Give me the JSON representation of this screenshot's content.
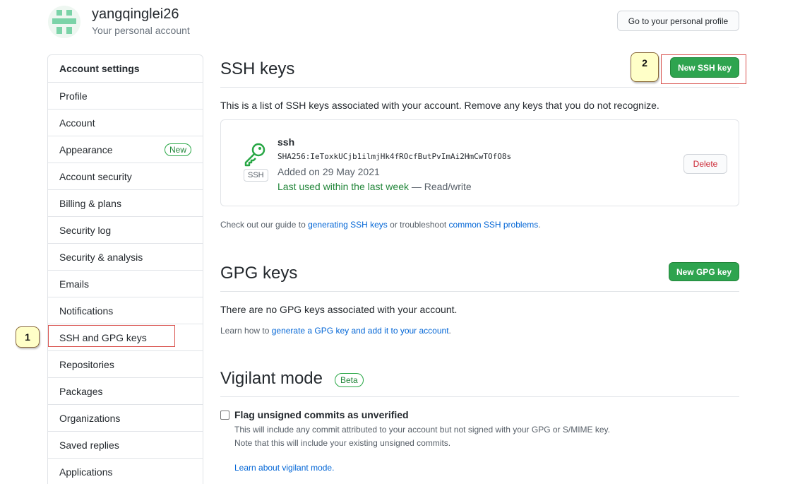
{
  "header": {
    "username": "yangqinglei26",
    "subtitle": "Your personal account",
    "profile_button": "Go to your personal profile"
  },
  "sidebar": {
    "heading": "Account settings",
    "items": [
      {
        "label": "Profile"
      },
      {
        "label": "Account"
      },
      {
        "label": "Appearance",
        "badge": "New"
      },
      {
        "label": "Account security"
      },
      {
        "label": "Billing & plans"
      },
      {
        "label": "Security log"
      },
      {
        "label": "Security & analysis"
      },
      {
        "label": "Emails"
      },
      {
        "label": "Notifications"
      },
      {
        "label": "SSH and GPG keys"
      },
      {
        "label": "Repositories"
      },
      {
        "label": "Packages"
      },
      {
        "label": "Organizations"
      },
      {
        "label": "Saved replies"
      },
      {
        "label": "Applications"
      }
    ]
  },
  "callouts": {
    "one": "1",
    "two": "2"
  },
  "ssh": {
    "title": "SSH keys",
    "new_button": "New SSH key",
    "description": "This is a list of SSH keys associated with your account. Remove any keys that you do not recognize.",
    "key": {
      "name": "ssh",
      "type_label": "SSH",
      "fingerprint": "SHA256:IeToxkUCjb1ilmjHk4fROcfButPvImAi2HmCwTOfO8s",
      "added": "Added on 29 May 2021",
      "last_used": "Last used within the last week",
      "access": " — Read/write",
      "delete_button": "Delete"
    },
    "guide_prefix": "Check out our guide to ",
    "guide_link1": "generating SSH keys",
    "guide_middle": " or troubleshoot ",
    "guide_link2": "common SSH problems",
    "guide_suffix": "."
  },
  "gpg": {
    "title": "GPG keys",
    "new_button": "New GPG key",
    "empty": "There are no GPG keys associated with your account.",
    "learn_prefix": "Learn how to ",
    "learn_link": "generate a GPG key and add it to your account",
    "learn_suffix": "."
  },
  "vigilant": {
    "title": "Vigilant mode",
    "badge": "Beta",
    "checkbox_label": "Flag unsigned commits as unverified",
    "note1": "This will include any commit attributed to your account but not signed with your GPG or S/MIME key.",
    "note2": "Note that this will include your existing unsigned commits.",
    "learn_link": "Learn about vigilant mode."
  },
  "colors": {
    "primary_green": "#2ea44f",
    "link_blue": "#0366d6",
    "danger_red": "#cb2431",
    "callout_fill": "#ffffc8",
    "highlight_red": "#d9534f"
  }
}
